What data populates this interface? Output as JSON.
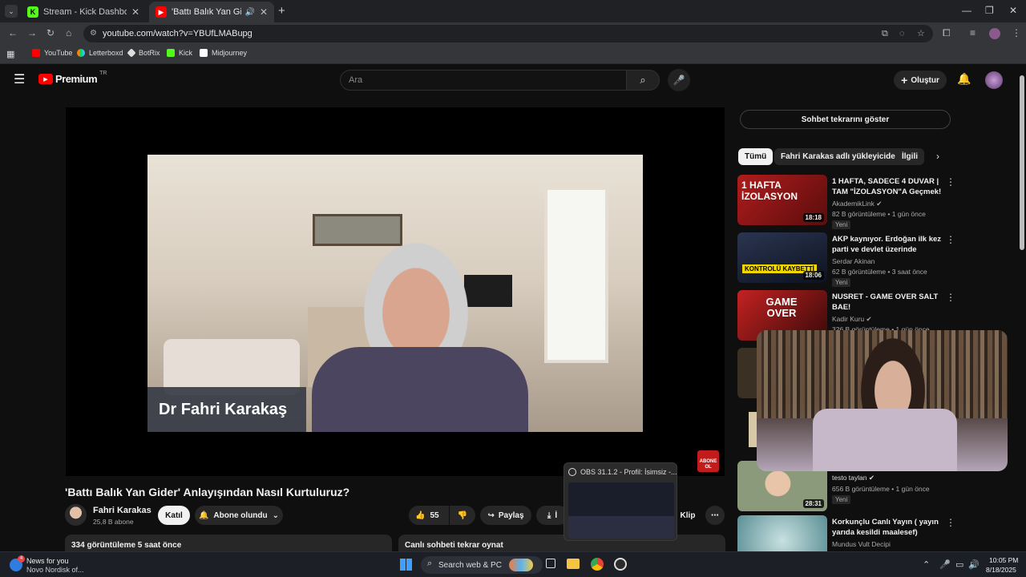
{
  "browser": {
    "tabs": [
      {
        "title": "Stream - Kick Dashboard",
        "active": false
      },
      {
        "title": "'Battı Balık Yan Gider' Anlayı",
        "active": true
      }
    ],
    "url": "youtube.com/watch?v=YBUfLMABupg",
    "bookmarks": [
      "YouTube",
      "Letterboxd",
      "BotRix",
      "Kick",
      "Midjourney"
    ]
  },
  "youtube": {
    "logo_text": "Premium",
    "logo_region": "TR",
    "search_placeholder": "Ara",
    "create_label": "Oluştur"
  },
  "video": {
    "lower_third": "Dr Fahri Karakaş",
    "title": "'Battı Balık Yan Gider' Anlayışından Nasıl Kurtuluruz?",
    "channel": "Fahri Karakas",
    "subscribers": "25,8 B abone",
    "join_label": "Katıl",
    "subscribed_label": "Abone olundu",
    "likes": "55",
    "share_label": "Paylaş",
    "download_label": "İ",
    "clip_label": "Klip",
    "views_line": "334 görüntüleme  5 saat önce",
    "chat_replay_line": "Canlı sohbeti tekrar oynat",
    "subscribe_watermark": "ABONE OL"
  },
  "sidebar": {
    "chat_replay_button": "Sohbet tekrarını göster",
    "chips": [
      "Tümü",
      "Fahri Karakas adlı yükleyiciden",
      "İlgili"
    ],
    "recommendations": [
      {
        "title": "1 HAFTA, SADECE 4 DUVAR | TAM \"İZOLASYON\"A Geçmek!",
        "channel": "AkademikLink",
        "verified": true,
        "meta": "82 B görüntüleme • 1 gün önce",
        "badge": "Yeni",
        "duration": "18:18",
        "thumb_text": "1 HAFTA İZOLASYON"
      },
      {
        "title": "AKP kaynıyor. Erdoğan ilk kez parti ve devlet üzerinde kontro...",
        "channel": "Serdar Akinan",
        "verified": false,
        "meta": "62 B görüntüleme • 3 saat önce",
        "badge": "Yeni",
        "duration": "18:06",
        "thumb_text": "KONTROLÜ KAYBETTİ"
      },
      {
        "title": "NUSRET - GAME OVER SALT BAE!",
        "channel": "Kadir Kuru",
        "verified": true,
        "meta": "326 B görüntüleme • 1 gün önce",
        "badge": "",
        "duration": "",
        "thumb_text": "GAME OVER"
      },
      {
        "title": "",
        "channel": "testo taylan",
        "verified": true,
        "meta": "656 B görüntüleme • 1 gün önce",
        "badge": "Yeni",
        "duration": "28:31",
        "thumb_text": ""
      },
      {
        "title": "Korkunçlu Canlı Yayın ( yayın yarıda kesildi maalesef)",
        "channel": "Mundus Vult Decipi",
        "verified": false,
        "meta": "",
        "badge": "",
        "duration": "",
        "thumb_text": ""
      }
    ]
  },
  "obs_popup": {
    "title": "OBS 31.1.2 - Profil: İsimsiz -..."
  },
  "taskbar": {
    "news_title": "News for you",
    "news_sub": "Novo Nordisk of...",
    "news_badge": "4",
    "search_label": "Search web & PC",
    "time": "10:05 PM",
    "date": "8/18/2025"
  },
  "colors": {
    "youtube_red": "#ff0000",
    "kick_green": "#53fc18",
    "bg": "#0f0f0f"
  }
}
